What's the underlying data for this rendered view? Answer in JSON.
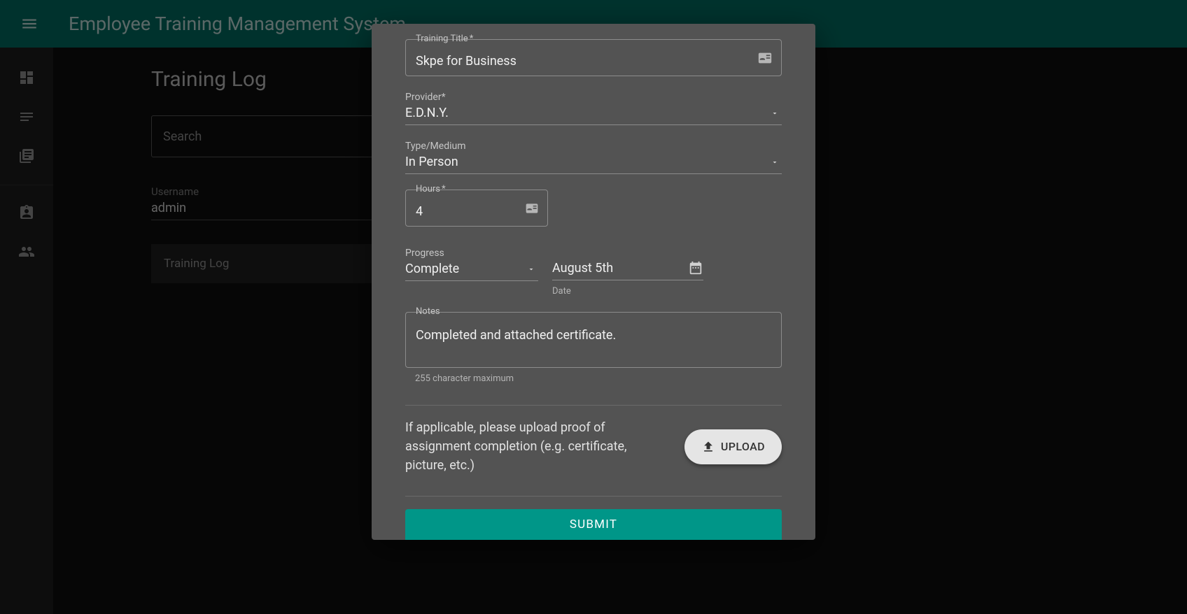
{
  "header": {
    "title": "Employee Training Management System"
  },
  "sidebar": {
    "items": [
      {
        "name": "dashboard"
      },
      {
        "name": "notes"
      },
      {
        "name": "library"
      },
      {
        "name": "assignment"
      },
      {
        "name": "group"
      }
    ]
  },
  "page": {
    "title": "Training Log",
    "search_placeholder": "Search",
    "username_label": "Username",
    "username_value": "admin",
    "row_label": "Training Log"
  },
  "dialog": {
    "training_title": {
      "label": "Training Title",
      "required": "*",
      "value": "Skpe for Business"
    },
    "provider": {
      "label": "Provider",
      "required": "*",
      "value": "E.D.N.Y."
    },
    "medium": {
      "label": "Type/Medium",
      "value": "In Person"
    },
    "hours": {
      "label": "Hours",
      "required": "*",
      "value": "4"
    },
    "progress": {
      "label": "Progress",
      "value": "Complete"
    },
    "date": {
      "value": "August 5th",
      "helper": "Date"
    },
    "notes": {
      "label": "Notes",
      "value": "Completed and attached certificate.",
      "helper": "255 character maximum"
    },
    "upload_text": "If applicable, please upload proof of assignment completion (e.g. certificate, picture, etc.)",
    "upload_button": "UPLOAD",
    "submit_button": "SUBMIT"
  },
  "colors": {
    "primary": "#009688",
    "appbar": "#006a5f"
  }
}
